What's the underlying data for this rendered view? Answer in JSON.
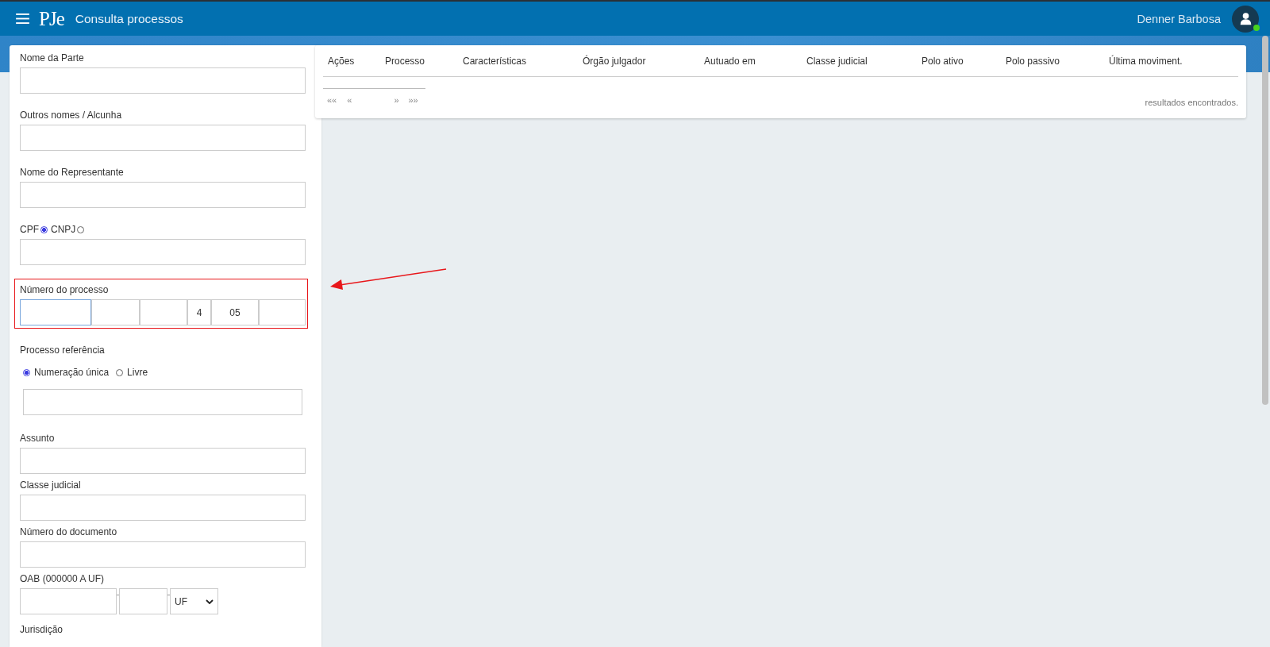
{
  "header": {
    "brand": "PJe",
    "title": "Consulta processos",
    "user": "Denner Barbosa",
    "online": true
  },
  "form": {
    "fields": [
      {
        "kind": "text",
        "label": "Nome da Parte"
      },
      {
        "kind": "text",
        "label": "Outros nomes / Alcunha"
      },
      {
        "kind": "text",
        "label": "Nome do Representante"
      },
      {
        "kind": "doc",
        "options": [
          {
            "label": "CPF",
            "selected": true
          },
          {
            "label": "CNPJ",
            "selected": false
          }
        ]
      },
      {
        "kind": "segments",
        "label": "Número do processo",
        "highlighted": true,
        "segments": [
          {
            "focused": true
          },
          {
            "focused": false
          },
          {
            "focused": false
          },
          {
            "value": "4",
            "focused": false
          },
          {
            "value": "05",
            "focused": false
          },
          {
            "focused": false
          }
        ]
      },
      {
        "kind": "reference",
        "label": "Processo referência",
        "options": [
          {
            "label": "Numeração única",
            "selected": true
          },
          {
            "label": "Livre",
            "selected": false
          }
        ]
      },
      {
        "kind": "text",
        "label": "Assunto"
      },
      {
        "kind": "text",
        "label": "Classe judicial"
      },
      {
        "kind": "text",
        "label": "Número do documento"
      },
      {
        "kind": "oab",
        "label": "OAB (000000 A UF)",
        "select": "UF"
      },
      {
        "kind": "cut",
        "label": "Jurisdição"
      }
    ]
  },
  "table": {
    "columns": [
      "Ações",
      "Processo",
      "Características",
      "Órgão julgador",
      "Autuado em",
      "Classe judicial",
      "Polo ativo",
      "Polo passivo",
      "Última moviment."
    ],
    "pager": [
      "««",
      "«",
      "»",
      "»»"
    ],
    "result_text": "resultados encontrados."
  }
}
